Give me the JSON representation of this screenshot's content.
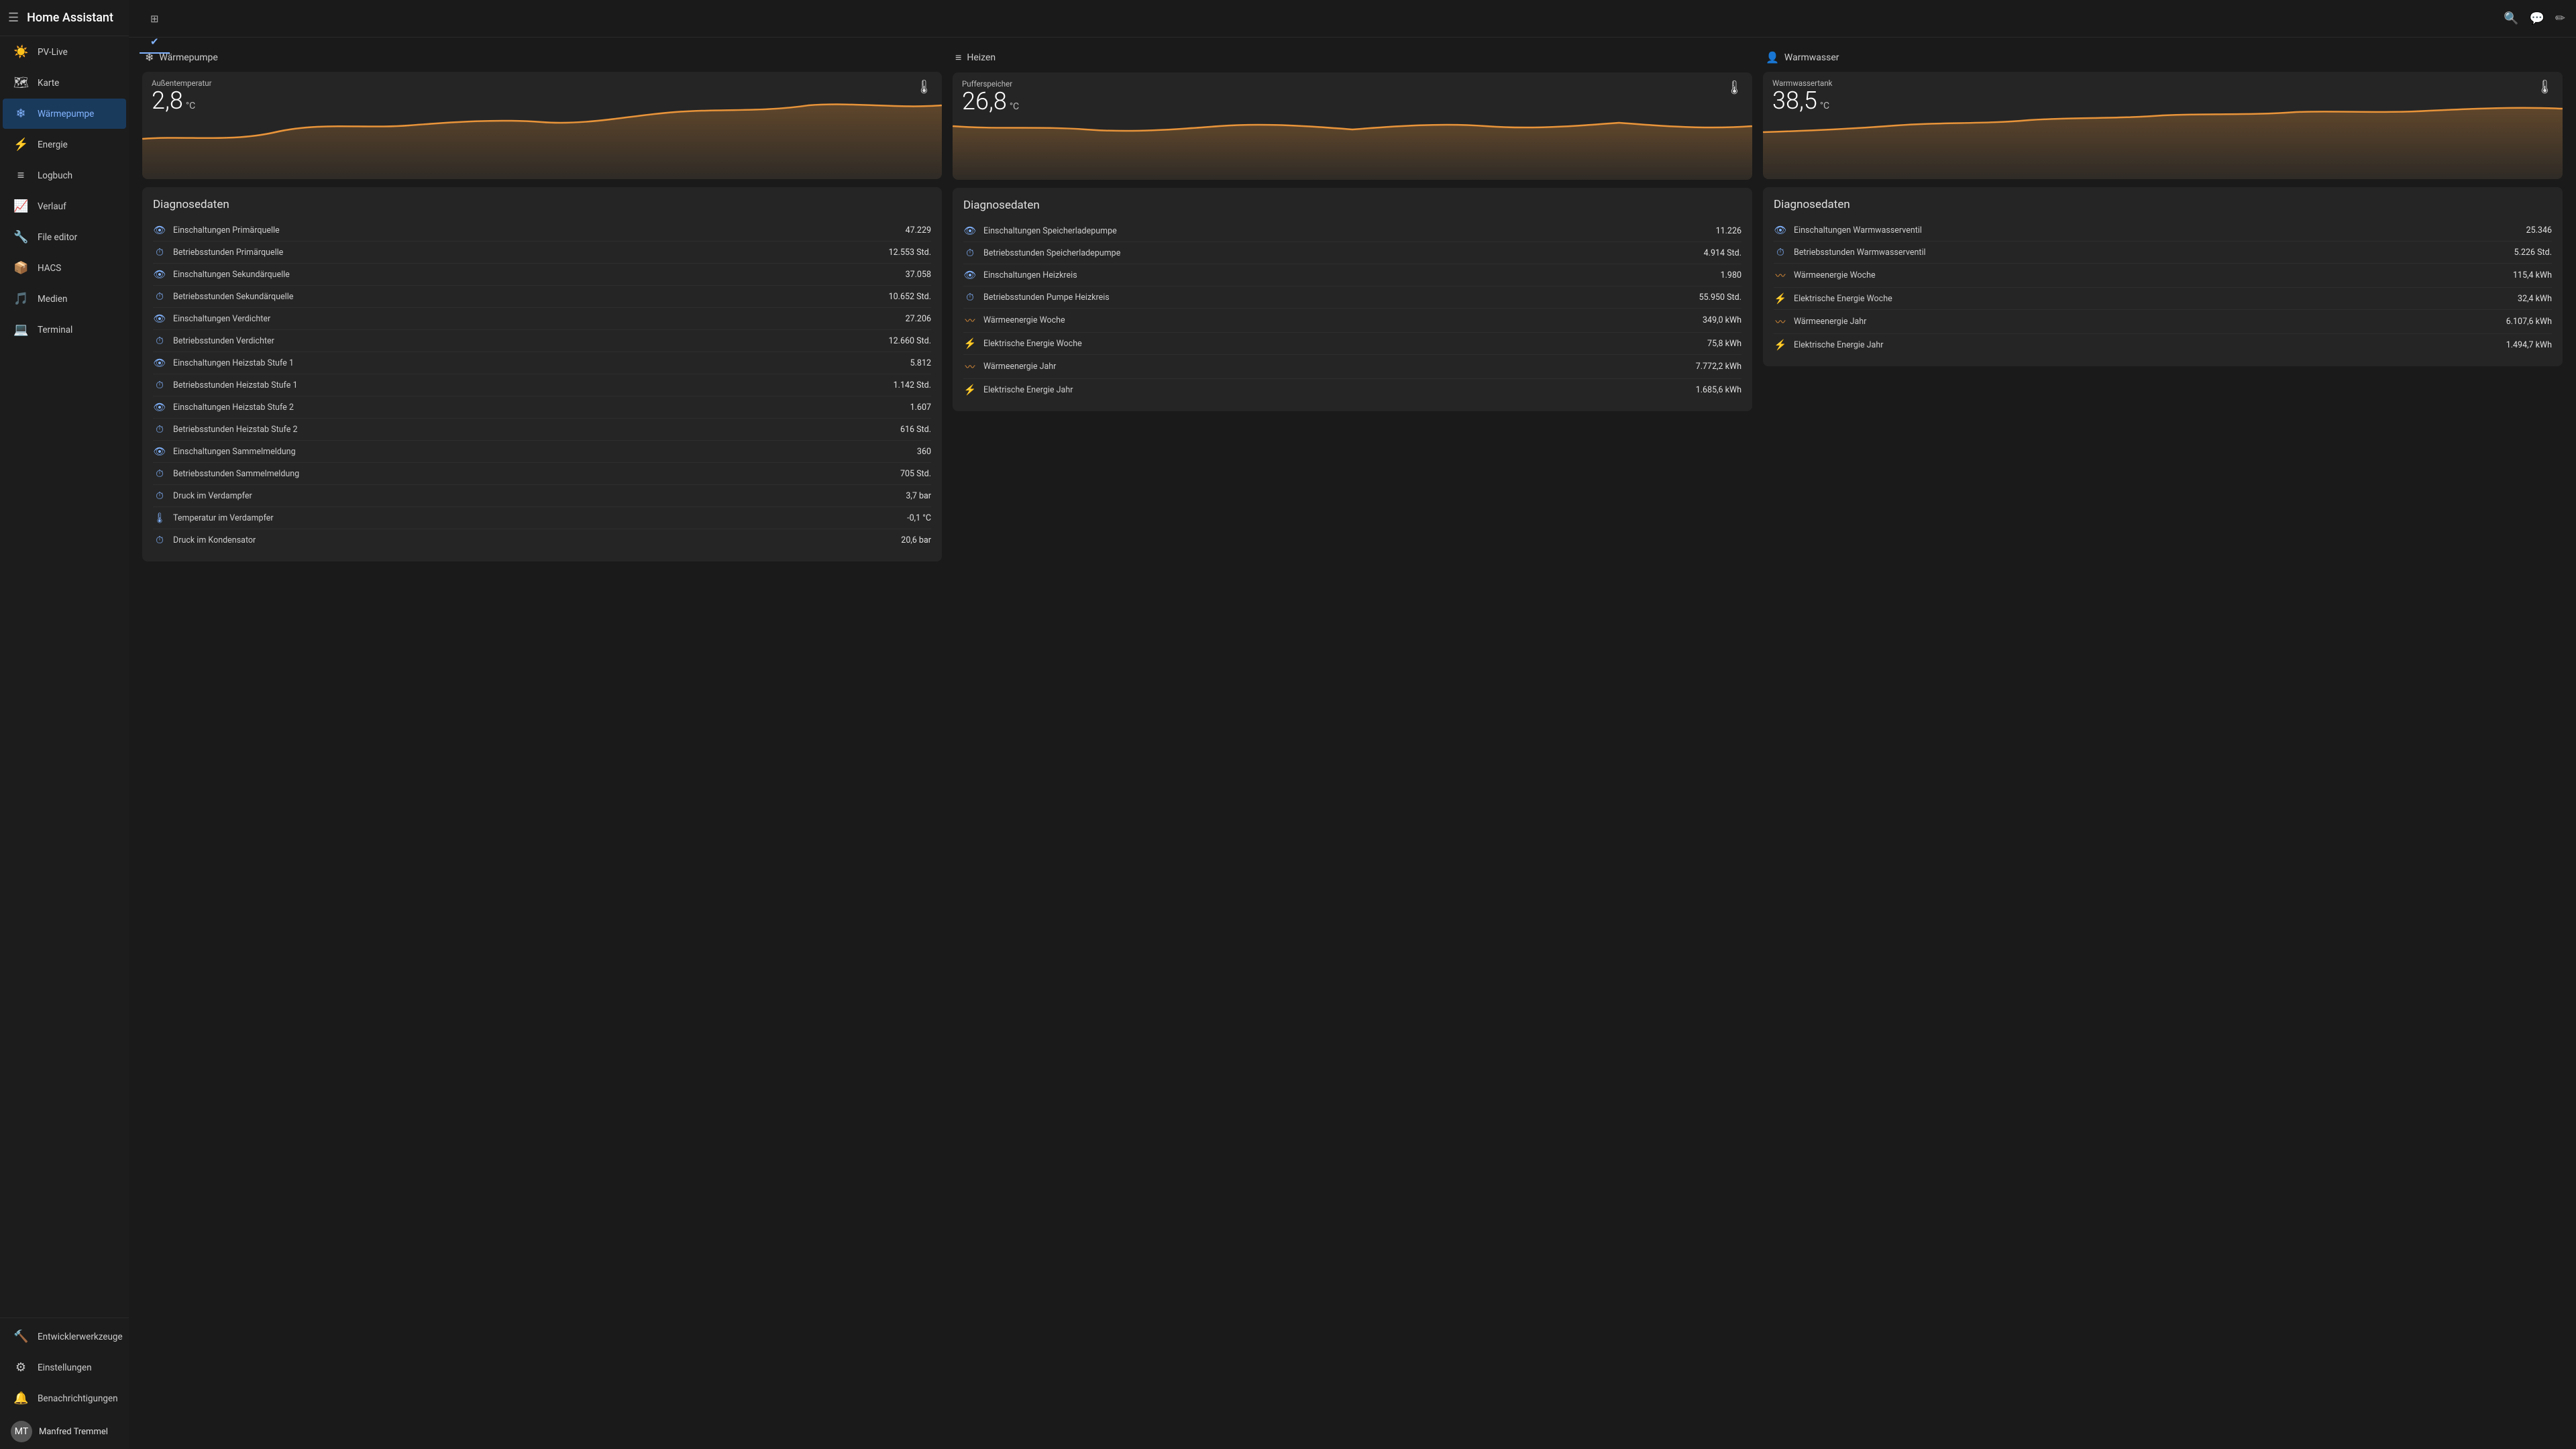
{
  "app": {
    "title": "Home Assistant"
  },
  "sidebar": {
    "items": [
      {
        "id": "pv-live",
        "label": "PV-Live",
        "icon": "☀️"
      },
      {
        "id": "karte",
        "label": "Karte",
        "icon": "🗺"
      },
      {
        "id": "waermepumpe",
        "label": "Wärmepumpe",
        "icon": "❄",
        "active": true
      },
      {
        "id": "energie",
        "label": "Energie",
        "icon": "⚡"
      },
      {
        "id": "logbuch",
        "label": "Logbuch",
        "icon": "≡"
      },
      {
        "id": "verlauf",
        "label": "Verlauf",
        "icon": "📈"
      },
      {
        "id": "file-editor",
        "label": "File editor",
        "icon": "🔧"
      },
      {
        "id": "hacs",
        "label": "HACS",
        "icon": "📦"
      },
      {
        "id": "medien",
        "label": "Medien",
        "icon": "🎵"
      },
      {
        "id": "terminal",
        "label": "Terminal",
        "icon": "💻"
      }
    ],
    "bottom_items": [
      {
        "id": "entwicklerwerkzeuge",
        "label": "Entwicklerwerkzeuge",
        "icon": "🔨"
      },
      {
        "id": "einstellungen",
        "label": "Einstellungen",
        "icon": "⚙"
      },
      {
        "id": "benachrichtigungen",
        "label": "Benachrichtigungen",
        "icon": "🔔"
      }
    ],
    "user": {
      "name": "Manfred Tremmel",
      "initials": "MT"
    }
  },
  "topbar": {
    "tabs": [
      {
        "id": "info",
        "icon": "ℹ",
        "active": false
      },
      {
        "id": "dashboard",
        "icon": "⊞",
        "active": false
      },
      {
        "id": "check",
        "icon": "✔",
        "active": true
      }
    ],
    "actions": {
      "search": "🔍",
      "chat": "💬",
      "edit": "✏"
    }
  },
  "columns": [
    {
      "id": "waermepumpe",
      "header": {
        "icon": "❄",
        "label": "Wärmepumpe"
      },
      "chart": {
        "label": "Außentemperatur",
        "value": "2,8",
        "unit": "°C",
        "thermo_icon": "🌡"
      },
      "diag": {
        "title": "Diagnosedaten",
        "rows": [
          {
            "icon": "eye",
            "label": "Einschaltungen Primärquelle",
            "value": "47.229"
          },
          {
            "icon": "clock",
            "label": "Betriebsstunden Primärquelle",
            "value": "12.553 Std."
          },
          {
            "icon": "eye",
            "label": "Einschaltungen Sekundärquelle",
            "value": "37.058"
          },
          {
            "icon": "clock",
            "label": "Betriebsstunden Sekundärquelle",
            "value": "10.652 Std."
          },
          {
            "icon": "eye",
            "label": "Einschaltungen Verdichter",
            "value": "27.206"
          },
          {
            "icon": "clock",
            "label": "Betriebsstunden Verdichter",
            "value": "12.660 Std."
          },
          {
            "icon": "eye",
            "label": "Einschaltungen Heizstab Stufe 1",
            "value": "5.812"
          },
          {
            "icon": "clock",
            "label": "Betriebsstunden Heizstab Stufe 1",
            "value": "1.142 Std."
          },
          {
            "icon": "eye",
            "label": "Einschaltungen Heizstab Stufe 2",
            "value": "1.607"
          },
          {
            "icon": "clock",
            "label": "Betriebsstunden Heizstab Stufe 2",
            "value": "616 Std."
          },
          {
            "icon": "eye",
            "label": "Einschaltungen Sammelmeldung",
            "value": "360"
          },
          {
            "icon": "clock",
            "label": "Betriebsstunden Sammelmeldung",
            "value": "705 Std."
          },
          {
            "icon": "clock",
            "label": "Druck im Verdampfer",
            "value": "3,7 bar"
          },
          {
            "icon": "thermo",
            "label": "Temperatur im Verdampfer",
            "value": "-0,1 °C"
          },
          {
            "icon": "clock",
            "label": "Druck im Kondensator",
            "value": "20,6 bar"
          }
        ]
      }
    },
    {
      "id": "heizen",
      "header": {
        "icon": "≡",
        "label": "Heizen"
      },
      "chart": {
        "label": "Pufferspeicher",
        "value": "26,8",
        "unit": "°C",
        "thermo_icon": "🌡"
      },
      "diag": {
        "title": "Diagnosedaten",
        "rows": [
          {
            "icon": "eye",
            "label": "Einschaltungen Speicherladepumpe",
            "value": "11.226"
          },
          {
            "icon": "clock",
            "label": "Betriebsstunden Speicherladepumpe",
            "value": "4.914 Std."
          },
          {
            "icon": "eye",
            "label": "Einschaltungen Heizkreis",
            "value": "1.980"
          },
          {
            "icon": "clock",
            "label": "Betriebsstunden Pumpe Heizkreis",
            "value": "55.950 Std."
          },
          {
            "icon": "flame",
            "label": "Wärmeenergie Woche",
            "value": "349,0 kWh"
          },
          {
            "icon": "bolt",
            "label": "Elektrische Energie Woche",
            "value": "75,8 kWh"
          },
          {
            "icon": "flame",
            "label": "Wärmeenergie Jahr",
            "value": "7.772,2 kWh"
          },
          {
            "icon": "bolt",
            "label": "Elektrische Energie Jahr",
            "value": "1.685,6 kWh"
          }
        ]
      }
    },
    {
      "id": "warmwasser",
      "header": {
        "icon": "👤",
        "label": "Warmwasser"
      },
      "chart": {
        "label": "Warmwassertank",
        "value": "38,5",
        "unit": "°C",
        "thermo_icon": "🌡"
      },
      "diag": {
        "title": "Diagnosedaten",
        "rows": [
          {
            "icon": "eye",
            "label": "Einschaltungen Warmwasserventil",
            "value": "25.346"
          },
          {
            "icon": "clock",
            "label": "Betriebsstunden Warmwasserventil",
            "value": "5.226 Std."
          },
          {
            "icon": "flame",
            "label": "Wärmeenergie Woche",
            "value": "115,4 kWh"
          },
          {
            "icon": "bolt",
            "label": "Elektrische Energie Woche",
            "value": "32,4 kWh"
          },
          {
            "icon": "flame",
            "label": "Wärmeenergie Jahr",
            "value": "6.107,6 kWh"
          },
          {
            "icon": "bolt",
            "label": "Elektrische Energie Jahr",
            "value": "1.494,7 kWh"
          }
        ]
      }
    }
  ]
}
